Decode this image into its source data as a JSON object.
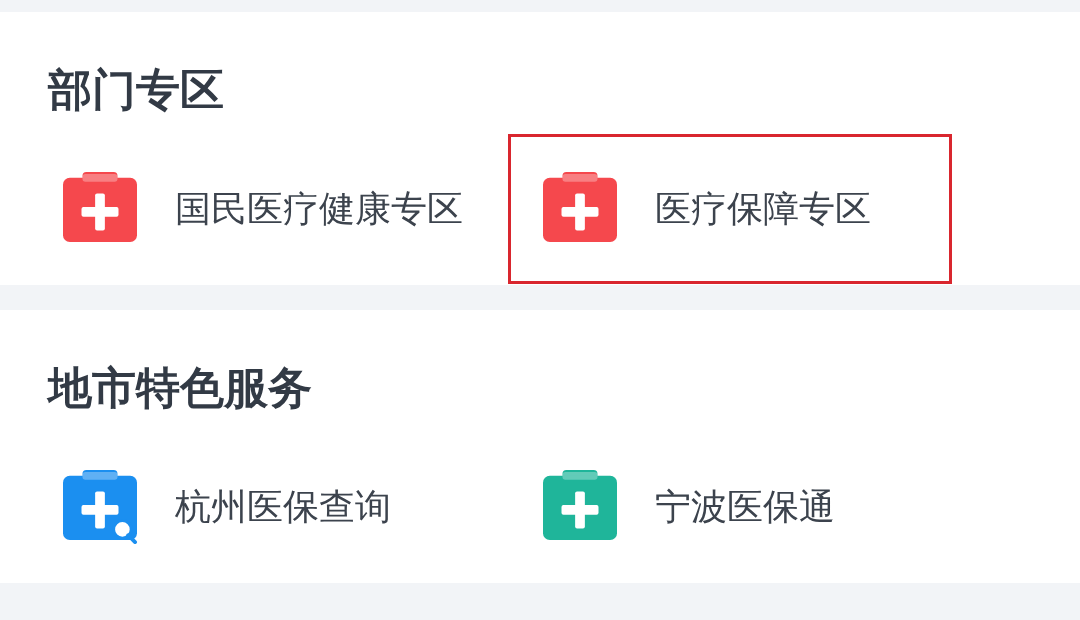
{
  "sections": [
    {
      "title": "部门专区",
      "items": [
        {
          "label": "国民医疗健康专区",
          "color": "#f5484d",
          "kind": "plain",
          "highlighted": false
        },
        {
          "label": "医疗保障专区",
          "color": "#f5484d",
          "kind": "plain",
          "highlighted": true
        }
      ]
    },
    {
      "title": "地市特色服务",
      "items": [
        {
          "label": "杭州医保查询",
          "color": "#1b8ff0",
          "kind": "search",
          "highlighted": false
        },
        {
          "label": "宁波医保通",
          "color": "#1fb59a",
          "kind": "plain",
          "highlighted": false
        }
      ]
    }
  ]
}
